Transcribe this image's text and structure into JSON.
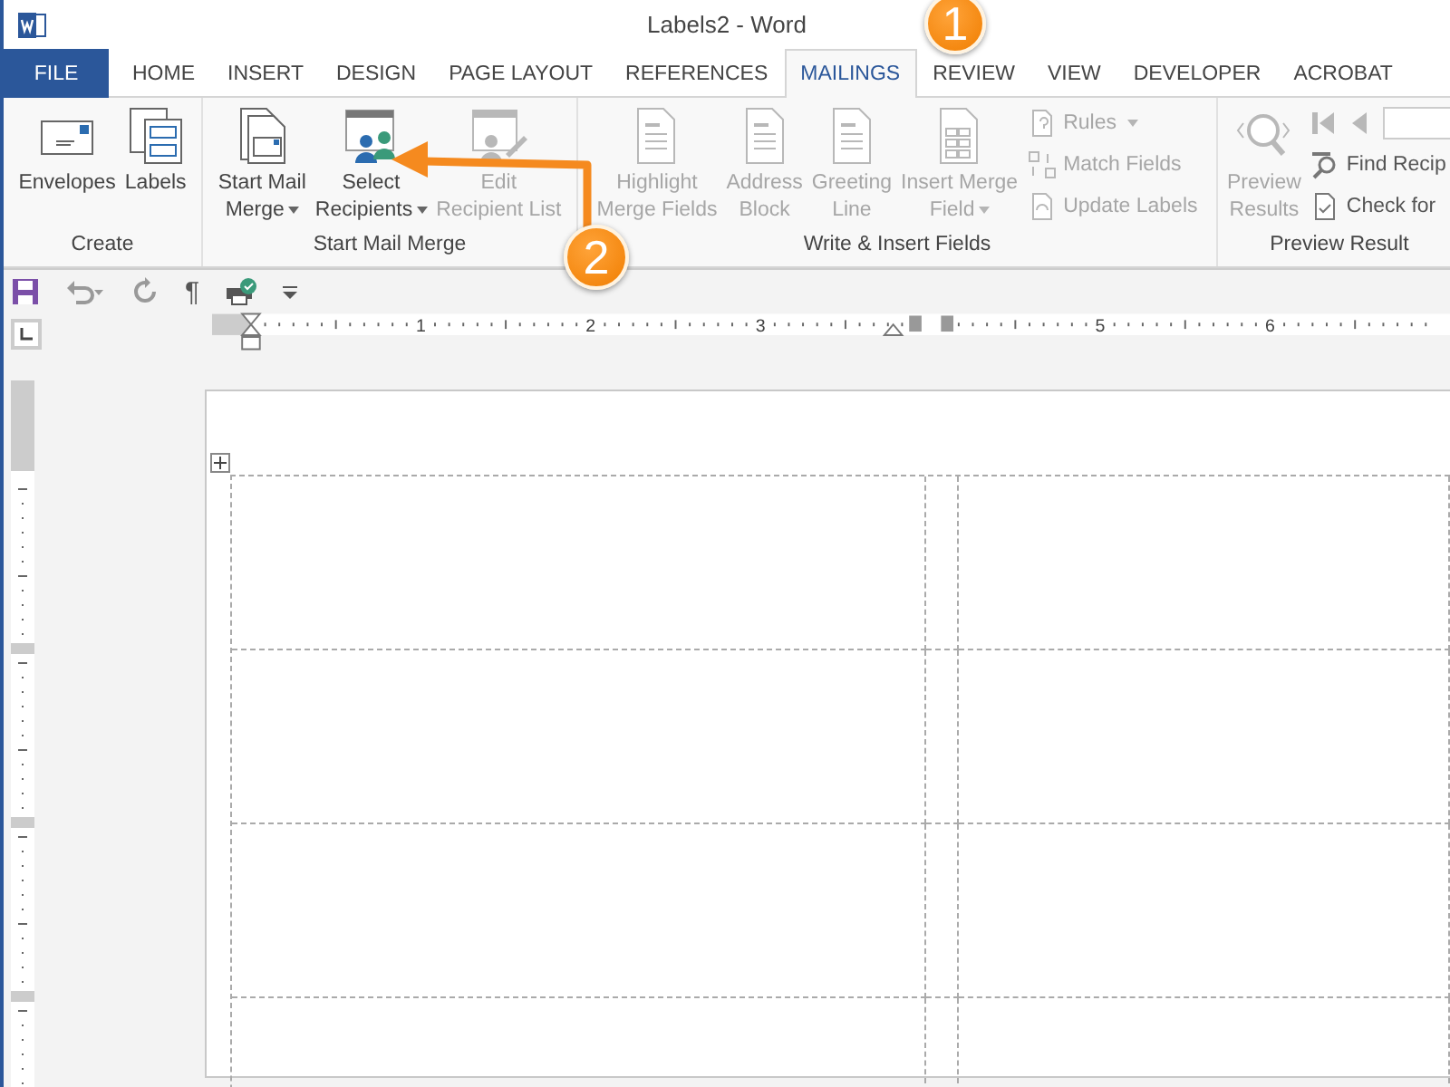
{
  "window": {
    "title": "Labels2 - Word"
  },
  "tabs": [
    {
      "label": "FILE",
      "kind": "file",
      "selected": false
    },
    {
      "label": "HOME",
      "kind": "tab",
      "selected": false
    },
    {
      "label": "INSERT",
      "kind": "tab",
      "selected": false
    },
    {
      "label": "DESIGN",
      "kind": "tab",
      "selected": false
    },
    {
      "label": "PAGE LAYOUT",
      "kind": "tab",
      "selected": false
    },
    {
      "label": "REFERENCES",
      "kind": "tab",
      "selected": false
    },
    {
      "label": "MAILINGS",
      "kind": "tab",
      "selected": true
    },
    {
      "label": "REVIEW",
      "kind": "tab",
      "selected": false
    },
    {
      "label": "VIEW",
      "kind": "tab",
      "selected": false
    },
    {
      "label": "DEVELOPER",
      "kind": "tab",
      "selected": false
    },
    {
      "label": "ACROBAT",
      "kind": "tab",
      "selected": false
    }
  ],
  "ribbon": {
    "groups": [
      {
        "label": "Create",
        "items": [
          {
            "kind": "large",
            "label": "Envelopes",
            "disabled": false,
            "dropdown": false
          },
          {
            "kind": "large",
            "label": "Labels",
            "disabled": false,
            "dropdown": false
          }
        ]
      },
      {
        "label": "Start Mail Merge",
        "items": [
          {
            "kind": "large",
            "label": "Start Mail\nMerge",
            "disabled": false,
            "dropdown": true
          },
          {
            "kind": "large",
            "label": "Select\nRecipients",
            "disabled": false,
            "dropdown": true
          },
          {
            "kind": "large",
            "label": "Edit\nRecipient List",
            "disabled": true,
            "dropdown": false
          }
        ]
      },
      {
        "label": "Write & Insert Fields",
        "items": [
          {
            "kind": "large",
            "label": "Highlight\nMerge Fields",
            "disabled": true,
            "dropdown": false
          },
          {
            "kind": "large",
            "label": "Address\nBlock",
            "disabled": true,
            "dropdown": false
          },
          {
            "kind": "large",
            "label": "Greeting\nLine",
            "disabled": true,
            "dropdown": false
          },
          {
            "kind": "large",
            "label": "Insert Merge\nField",
            "disabled": true,
            "dropdown": true
          },
          {
            "kind": "small",
            "label": "Rules",
            "disabled": true,
            "dropdown": true
          },
          {
            "kind": "small",
            "label": "Match Fields",
            "disabled": true,
            "dropdown": false
          },
          {
            "kind": "small",
            "label": "Update Labels",
            "disabled": true,
            "dropdown": false
          }
        ]
      },
      {
        "label": "Preview Result",
        "items": [
          {
            "kind": "large",
            "label": "Preview\nResults",
            "disabled": true,
            "dropdown": false
          },
          {
            "kind": "navrow",
            "disabled": true
          },
          {
            "kind": "small",
            "label": "Find Recip",
            "disabled": false,
            "dropdown": false
          },
          {
            "kind": "small",
            "label": "Check for",
            "disabled": false,
            "dropdown": false
          }
        ]
      }
    ]
  },
  "quick_access": {
    "pilcrow": "¶"
  },
  "ruler": {
    "numbers": [
      "1",
      "2",
      "3",
      "5",
      "6"
    ]
  },
  "callouts": [
    {
      "label": "1"
    },
    {
      "label": "2"
    }
  ]
}
